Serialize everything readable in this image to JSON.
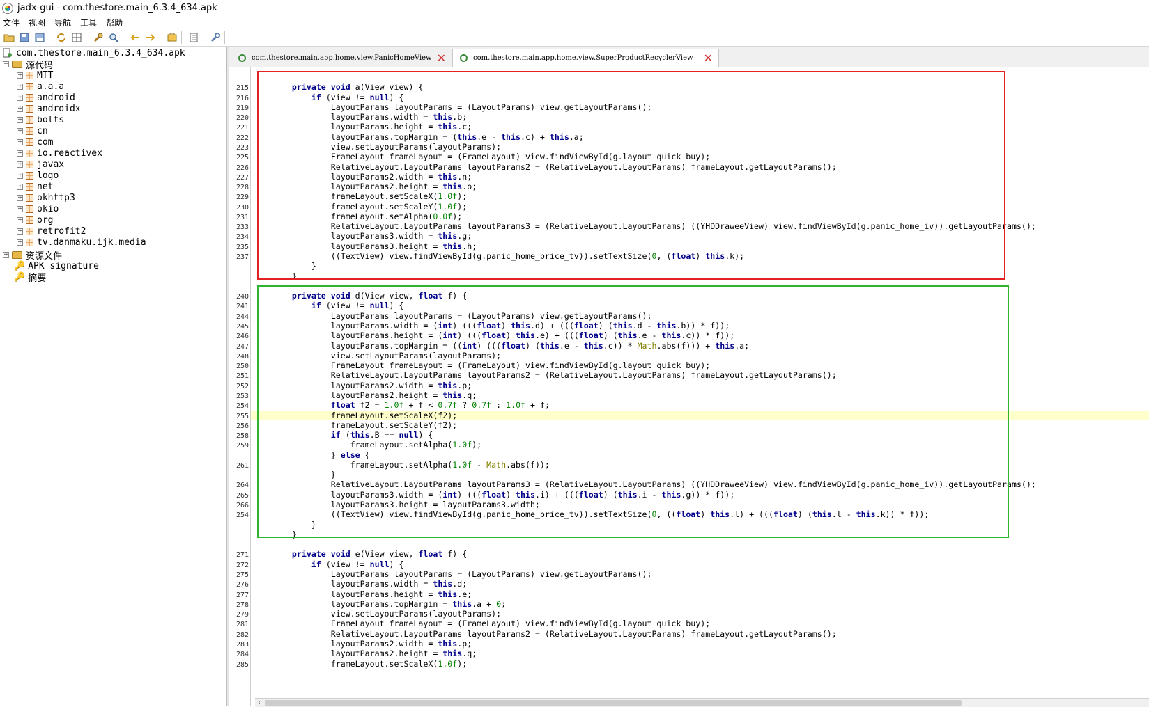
{
  "window": {
    "title": "jadx-gui - com.thestore.main_6.3.4_634.apk"
  },
  "menu": [
    "文件",
    "视图",
    "导航",
    "工具",
    "帮助"
  ],
  "toolbar_icons": [
    "open-file-icon",
    "save-all-icon",
    "export-icon",
    "sync-icon",
    "flatten-packages-icon",
    "search-text-icon",
    "find-class-icon",
    "back-icon",
    "forward-icon",
    "deobfuscation-icon",
    "log-viewer-icon",
    "preferences-icon"
  ],
  "tree": {
    "root": "com.thestore.main_6.3.4_634.apk",
    "source_node": "源代码",
    "packages": [
      "MTT",
      "a.a.a",
      "android",
      "androidx",
      "bolts",
      "cn",
      "com",
      "io.reactivex",
      "javax",
      "logo",
      "net",
      "okhttp3",
      "okio",
      "org",
      "retrofit2",
      "tv.danmaku.ijk.media"
    ],
    "resources_node": "资源文件",
    "signature_node": "APK signature",
    "summary_node": "摘要"
  },
  "tabs": [
    {
      "label": "com.thestore.main.app.home.view.PanicHomeView",
      "active": false
    },
    {
      "label": "com.thestore.main.app.home.view.SuperProductRecyclerView",
      "active": true
    }
  ],
  "code": [
    {
      "ln": "",
      "text": ""
    },
    {
      "ln": "215",
      "text": "    private void a(View view) {"
    },
    {
      "ln": "216",
      "text": "        if (view != null) {"
    },
    {
      "ln": "219",
      "text": "            LayoutParams layoutParams = (LayoutParams) view.getLayoutParams();"
    },
    {
      "ln": "220",
      "text": "            layoutParams.width = this.b;"
    },
    {
      "ln": "221",
      "text": "            layoutParams.height = this.c;"
    },
    {
      "ln": "222",
      "text": "            layoutParams.topMargin = (this.e - this.c) + this.a;"
    },
    {
      "ln": "223",
      "text": "            view.setLayoutParams(layoutParams);"
    },
    {
      "ln": "225",
      "text": "            FrameLayout frameLayout = (FrameLayout) view.findViewById(g.layout_quick_buy);"
    },
    {
      "ln": "226",
      "text": "            RelativeLayout.LayoutParams layoutParams2 = (RelativeLayout.LayoutParams) frameLayout.getLayoutParams();"
    },
    {
      "ln": "227",
      "text": "            layoutParams2.width = this.n;"
    },
    {
      "ln": "228",
      "text": "            layoutParams2.height = this.o;"
    },
    {
      "ln": "229",
      "text": "            frameLayout.setScaleX(1.0f);"
    },
    {
      "ln": "230",
      "text": "            frameLayout.setScaleY(1.0f);"
    },
    {
      "ln": "231",
      "text": "            frameLayout.setAlpha(0.0f);"
    },
    {
      "ln": "233",
      "text": "            RelativeLayout.LayoutParams layoutParams3 = (RelativeLayout.LayoutParams) ((YHDDraweeView) view.findViewById(g.panic_home_iv)).getLayoutParams();"
    },
    {
      "ln": "234",
      "text": "            layoutParams3.width = this.g;"
    },
    {
      "ln": "235",
      "text": "            layoutParams3.height = this.h;"
    },
    {
      "ln": "237",
      "text": "            ((TextView) view.findViewById(g.panic_home_price_tv)).setTextSize(0, (float) this.k);"
    },
    {
      "ln": "",
      "text": "        }"
    },
    {
      "ln": "",
      "text": "    }"
    },
    {
      "ln": "",
      "text": ""
    },
    {
      "ln": "240",
      "text": "    private void d(View view, float f) {"
    },
    {
      "ln": "241",
      "text": "        if (view != null) {"
    },
    {
      "ln": "244",
      "text": "            LayoutParams layoutParams = (LayoutParams) view.getLayoutParams();"
    },
    {
      "ln": "245",
      "text": "            layoutParams.width = (int) (((float) this.d) + (((float) (this.d - this.b)) * f));"
    },
    {
      "ln": "246",
      "text": "            layoutParams.height = (int) (((float) this.e) + (((float) (this.e - this.c)) * f));"
    },
    {
      "ln": "247",
      "text": "            layoutParams.topMargin = ((int) (((float) (this.e - this.c)) * Math.abs(f))) + this.a;"
    },
    {
      "ln": "248",
      "text": "            view.setLayoutParams(layoutParams);"
    },
    {
      "ln": "250",
      "text": "            FrameLayout frameLayout = (FrameLayout) view.findViewById(g.layout_quick_buy);"
    },
    {
      "ln": "251",
      "text": "            RelativeLayout.LayoutParams layoutParams2 = (RelativeLayout.LayoutParams) frameLayout.getLayoutParams();"
    },
    {
      "ln": "252",
      "text": "            layoutParams2.width = this.p;"
    },
    {
      "ln": "253",
      "text": "            layoutParams2.height = this.q;"
    },
    {
      "ln": "254",
      "text": "            float f2 = 1.0f + f < 0.7f ? 0.7f : 1.0f + f;"
    },
    {
      "ln": "255",
      "text": "            frameLayout.setScaleX(f2);",
      "highlight": true
    },
    {
      "ln": "256",
      "text": "            frameLayout.setScaleY(f2);"
    },
    {
      "ln": "258",
      "text": "            if (this.B == null) {"
    },
    {
      "ln": "259",
      "text": "                frameLayout.setAlpha(1.0f);"
    },
    {
      "ln": "",
      "text": "            } else {"
    },
    {
      "ln": "261",
      "text": "                frameLayout.setAlpha(1.0f - Math.abs(f));"
    },
    {
      "ln": "",
      "text": "            }"
    },
    {
      "ln": "264",
      "text": "            RelativeLayout.LayoutParams layoutParams3 = (RelativeLayout.LayoutParams) ((YHDDraweeView) view.findViewById(g.panic_home_iv)).getLayoutParams();"
    },
    {
      "ln": "265",
      "text": "            layoutParams3.width = (int) (((float) this.i) + (((float) (this.i - this.g)) * f));"
    },
    {
      "ln": "266",
      "text": "            layoutParams3.height = layoutParams3.width;"
    },
    {
      "ln": "254",
      "text": "            ((TextView) view.findViewById(g.panic_home_price_tv)).setTextSize(0, ((float) this.l) + (((float) (this.l - this.k)) * f));"
    },
    {
      "ln": "",
      "text": "        }"
    },
    {
      "ln": "",
      "text": "    }"
    },
    {
      "ln": "",
      "text": ""
    },
    {
      "ln": "271",
      "text": "    private void e(View view, float f) {"
    },
    {
      "ln": "272",
      "text": "        if (view != null) {"
    },
    {
      "ln": "275",
      "text": "            LayoutParams layoutParams = (LayoutParams) view.getLayoutParams();"
    },
    {
      "ln": "276",
      "text": "            layoutParams.width = this.d;"
    },
    {
      "ln": "277",
      "text": "            layoutParams.height = this.e;"
    },
    {
      "ln": "278",
      "text": "            layoutParams.topMargin = this.a + 0;"
    },
    {
      "ln": "279",
      "text": "            view.setLayoutParams(layoutParams);"
    },
    {
      "ln": "281",
      "text": "            FrameLayout frameLayout = (FrameLayout) view.findViewById(g.layout_quick_buy);"
    },
    {
      "ln": "282",
      "text": "            RelativeLayout.LayoutParams layoutParams2 = (RelativeLayout.LayoutParams) frameLayout.getLayoutParams();"
    },
    {
      "ln": "283",
      "text": "            layoutParams2.width = this.p;"
    },
    {
      "ln": "284",
      "text": "            layoutParams2.height = this.q;"
    },
    {
      "ln": "285",
      "text": "            frameLayout.setScaleX(1.0f);"
    }
  ],
  "colors": {
    "keyword": "#00008b",
    "number": "#008000",
    "highlight_line": "#ffffcc",
    "annotation_red": "#e52222",
    "annotation_green": "#2db52d"
  }
}
